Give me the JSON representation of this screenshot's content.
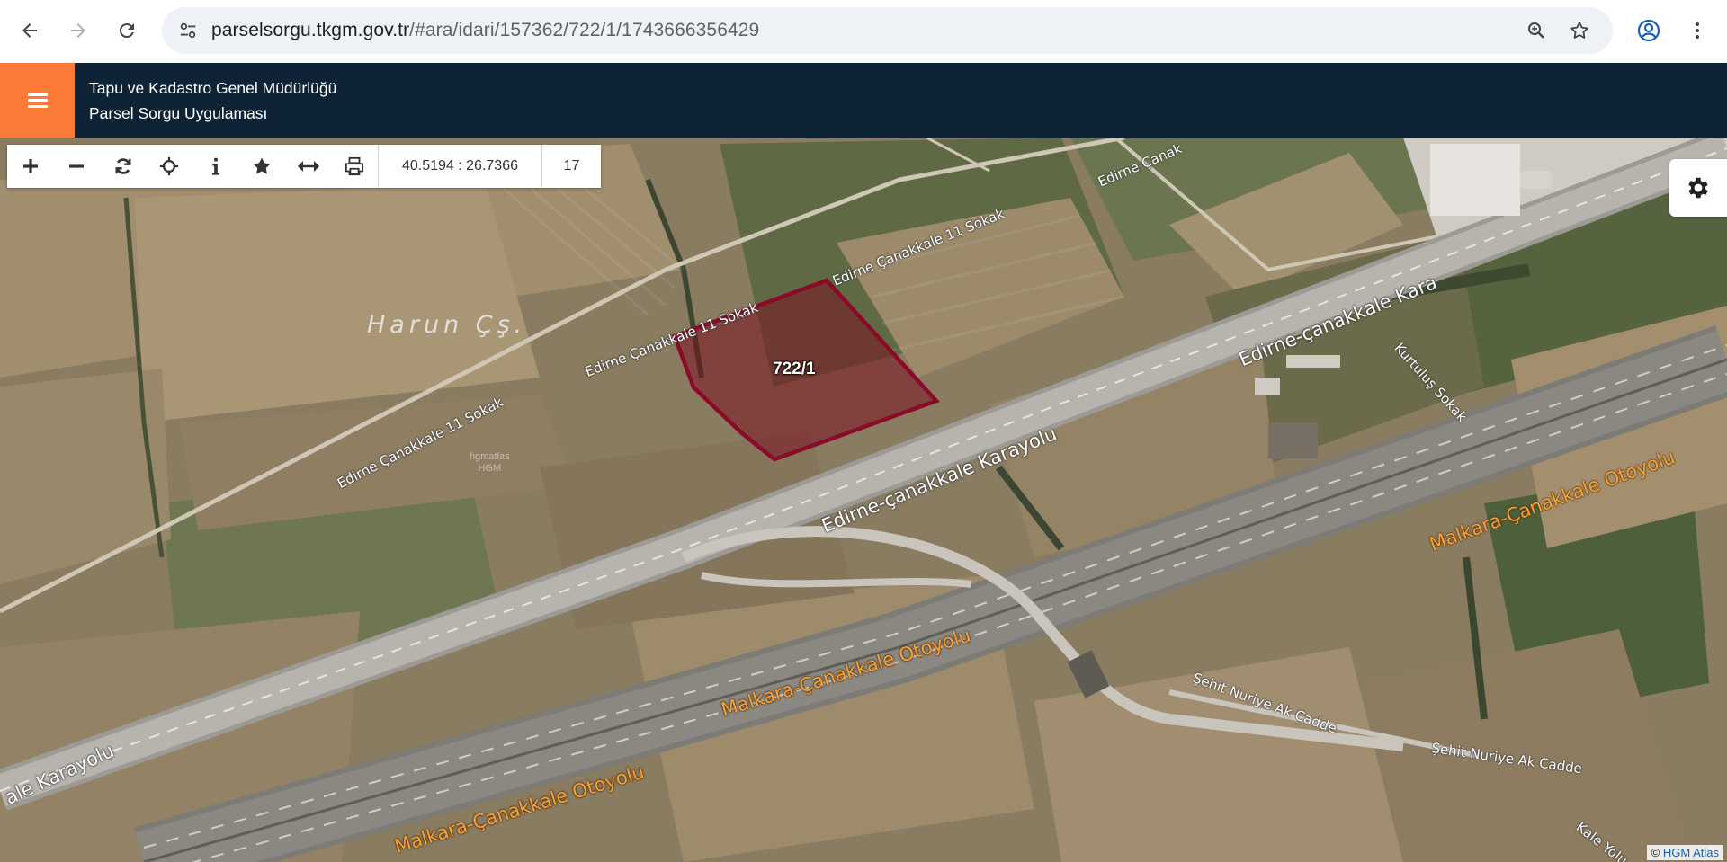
{
  "browser": {
    "url_host": "parselsorgu.tkgm.gov.tr",
    "url_path": "/#ara/idari/157362/722/1/1743666356429",
    "icons": [
      "back-arrow-icon",
      "forward-arrow-icon",
      "reload-icon",
      "site-settings-icon",
      "zoom-icon",
      "bookmark-star-icon",
      "profile-icon",
      "kebab-menu-icon"
    ]
  },
  "header": {
    "title": "Tapu ve Kadastro Genel Müdürlüğü",
    "subtitle": "Parsel Sorgu Uygulaması",
    "accent_color": "#fd7b39",
    "bg_color": "#0e2436"
  },
  "toolbar": {
    "buttons": [
      "zoom-in-icon",
      "zoom-out-icon",
      "refresh-icon",
      "locate-icon",
      "info-icon",
      "favorite-star-icon",
      "measure-icon",
      "print-icon"
    ],
    "coordinates": "40.5194 : 26.7366",
    "zoom_level": "17"
  },
  "map": {
    "parcel_label": "722/1",
    "parcel_color": "#8b0a2a",
    "place_name": "Harun Çş.",
    "roads": {
      "sokak_1": "Edirne Çanakkale 11 Sokak",
      "sokak_2": "Edirne Çanakkale 11 Sokak",
      "sokak_3": "Edirne Çanakkale 11 Sokak",
      "sokak_4": "Edirne Çanak",
      "karayolu_1": "Edirne-çanakkale Karayolu",
      "karayolu_2": "Edirne-çanakkale Kara",
      "karayolu_3": "ale Karayolu",
      "otoyol_1": "Malkara-Çanakkale Otoyolu",
      "otoyol_2": "Malkara-Çanakkale Otoyolu",
      "otoyol_3": "Malkara-Çanakkale Otoyolu",
      "kurtulus": "Kurtuluş Sokak",
      "sehit_1": "Şehit Nuriye Ak Cadde",
      "sehit_2": "Şehit Nuriye Ak Cadde",
      "kale": "Kale Yolu"
    },
    "watermark_1": "hgmatlas",
    "watermark_2": "HGM"
  },
  "attribution": {
    "prefix": "©",
    "link": "HGM Atlas"
  }
}
